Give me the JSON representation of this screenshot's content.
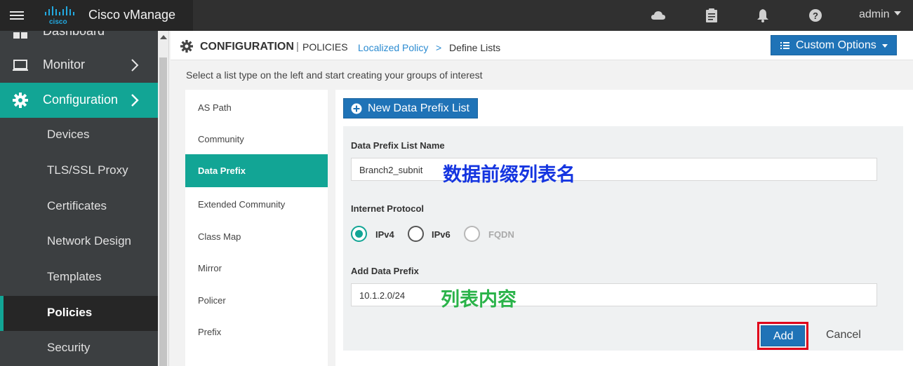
{
  "app": {
    "brand": "cisco",
    "title": "Cisco vManage",
    "user": "admin"
  },
  "top_icons": [
    "cloud-icon",
    "clipboard-icon",
    "bell-icon",
    "help-icon"
  ],
  "sidebar": {
    "cut_off_item": "Dashboard",
    "main": [
      {
        "label": "Monitor",
        "icon": "monitor-icon"
      },
      {
        "label": "Configuration",
        "icon": "gear-icon",
        "active": true
      }
    ],
    "sub": [
      {
        "label": "Devices"
      },
      {
        "label": "TLS/SSL Proxy"
      },
      {
        "label": "Certificates"
      },
      {
        "label": "Network Design"
      },
      {
        "label": "Templates"
      },
      {
        "label": "Policies",
        "active": true
      },
      {
        "label": "Security"
      }
    ]
  },
  "header": {
    "section": "CONFIGURATION",
    "separator": "|",
    "page": "POLICIES",
    "breadcrumb_link": "Localized Policy",
    "breadcrumb_sep": ">",
    "breadcrumb_current": "Define Lists",
    "custom_options": "Custom Options"
  },
  "instruction": "Select a list type on the left and start creating your groups of interest",
  "list_types": [
    {
      "label": "AS Path"
    },
    {
      "label": "Community"
    },
    {
      "label": "Data Prefix",
      "active": true
    },
    {
      "label": "Extended Community"
    },
    {
      "label": "Class Map"
    },
    {
      "label": "Mirror"
    },
    {
      "label": "Policer"
    },
    {
      "label": "Prefix"
    }
  ],
  "form": {
    "new_button": "New Data Prefix List",
    "name_label": "Data Prefix List Name",
    "name_value": "Branch2_subnit",
    "name_annotation": "数据前缀列表名",
    "protocol_label": "Internet Protocol",
    "protocols": [
      {
        "label": "IPv4",
        "state": "checked"
      },
      {
        "label": "IPv6",
        "state": "unchecked"
      },
      {
        "label": "FQDN",
        "state": "disabled"
      }
    ],
    "prefix_label": "Add Data Prefix",
    "prefix_value": "10.1.2.0/24",
    "prefix_annotation": "列表内容",
    "add_button": "Add",
    "cancel_button": "Cancel"
  },
  "colors": {
    "teal": "#12a595",
    "primary": "#1f73b7",
    "annotation_blue": "#1535e0",
    "annotation_green": "#2bb34a",
    "highlight_red": "#e0001a"
  }
}
